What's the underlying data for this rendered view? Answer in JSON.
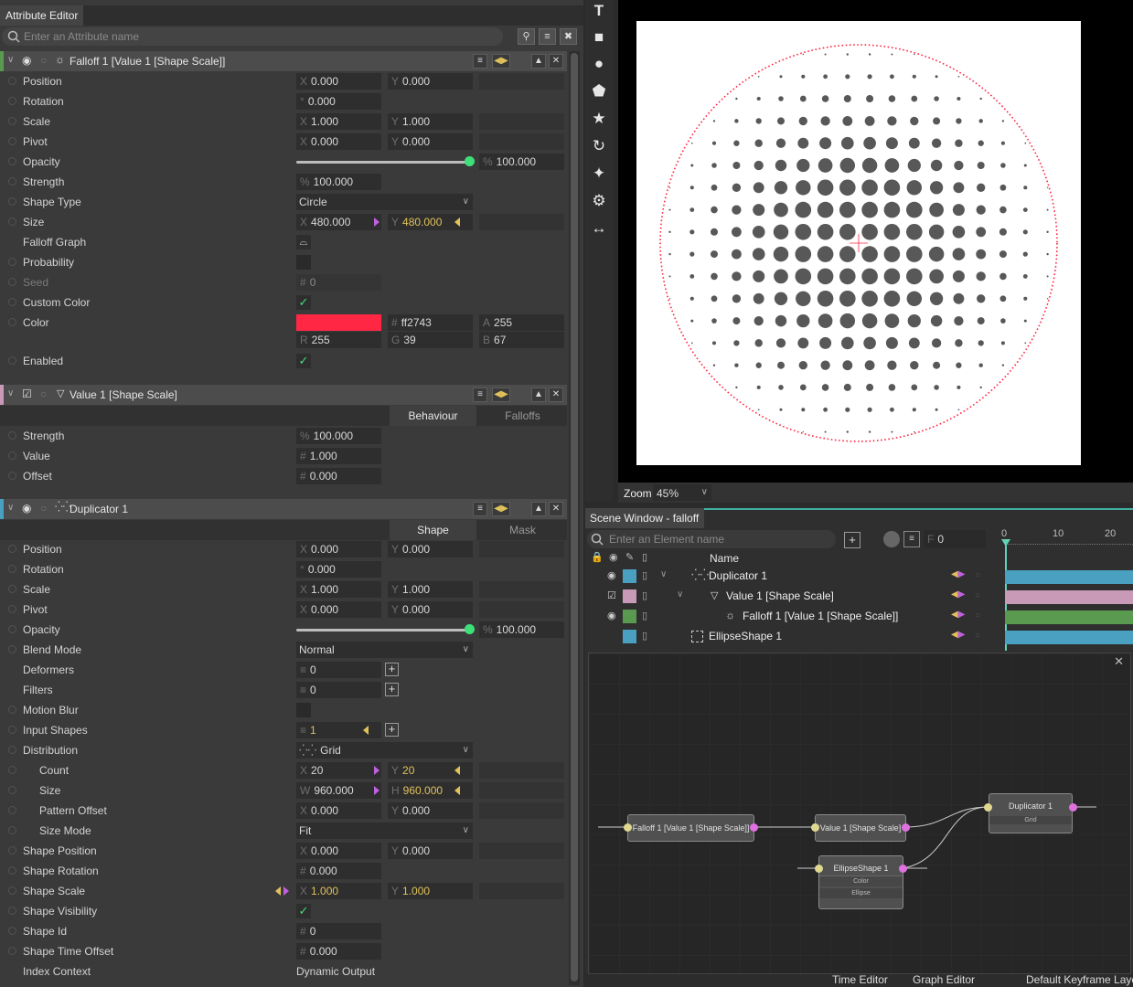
{
  "attribute_editor": {
    "title": "Attribute Editor",
    "search_placeholder": "Enter an Attribute name",
    "falloff": {
      "title": "Falloff 1 [Value 1 [Shape Scale]]",
      "position": {
        "label": "Position",
        "x": "0.000",
        "y": "0.000"
      },
      "rotation": {
        "label": "Rotation",
        "value": "0.000"
      },
      "scale": {
        "label": "Scale",
        "x": "1.000",
        "y": "1.000"
      },
      "pivot": {
        "label": "Pivot",
        "x": "0.000",
        "y": "0.000"
      },
      "opacity": {
        "label": "Opacity",
        "value": "100.000",
        "level": 1.0
      },
      "strength": {
        "label": "Strength",
        "value": "100.000"
      },
      "shape_type": {
        "label": "Shape Type",
        "value": "Circle"
      },
      "size": {
        "label": "Size",
        "x": "480.000",
        "y": "480.000"
      },
      "falloff_graph": {
        "label": "Falloff Graph"
      },
      "probability": {
        "label": "Probability"
      },
      "seed": {
        "label": "Seed",
        "value": "0"
      },
      "custom_color": {
        "label": "Custom Color"
      },
      "color": {
        "label": "Color",
        "swatch": "#ff2743",
        "hex": "ff2743",
        "a": "255",
        "r": "255",
        "g": "39",
        "b": "67"
      },
      "enabled": {
        "label": "Enabled"
      }
    },
    "value": {
      "title": "Value 1 [Shape Scale]",
      "tabs": [
        "Behaviour",
        "Falloffs"
      ],
      "strength": {
        "label": "Strength",
        "value": "100.000"
      },
      "value": {
        "label": "Value",
        "value": "1.000"
      },
      "offset": {
        "label": "Offset",
        "value": "0.000"
      }
    },
    "duplicator": {
      "title": "Duplicator 1",
      "tabs": [
        "Shape",
        "Mask"
      ],
      "position": {
        "label": "Position",
        "x": "0.000",
        "y": "0.000"
      },
      "rotation": {
        "label": "Rotation",
        "value": "0.000"
      },
      "scale": {
        "label": "Scale",
        "x": "1.000",
        "y": "1.000"
      },
      "pivot": {
        "label": "Pivot",
        "x": "0.000",
        "y": "0.000"
      },
      "opacity": {
        "label": "Opacity",
        "value": "100.000",
        "level": 1.0
      },
      "blend_mode": {
        "label": "Blend Mode",
        "value": "Normal"
      },
      "deformers": {
        "label": "Deformers",
        "value": "0"
      },
      "filters": {
        "label": "Filters",
        "value": "0"
      },
      "motion_blur": {
        "label": "Motion Blur"
      },
      "input_shapes": {
        "label": "Input Shapes",
        "value": "1"
      },
      "distribution": {
        "label": "Distribution",
        "value": "Grid"
      },
      "count": {
        "label": "Count",
        "x": "20",
        "y": "20"
      },
      "size": {
        "label": "Size",
        "w": "960.000",
        "h": "960.000"
      },
      "pattern_offset": {
        "label": "Pattern Offset",
        "x": "0.000",
        "y": "0.000"
      },
      "size_mode": {
        "label": "Size Mode",
        "value": "Fit"
      },
      "shape_position": {
        "label": "Shape Position",
        "x": "0.000",
        "y": "0.000"
      },
      "shape_rotation": {
        "label": "Shape Rotation",
        "value": "0.000"
      },
      "shape_scale": {
        "label": "Shape Scale",
        "x": "1.000",
        "y": "1.000"
      },
      "shape_visibility": {
        "label": "Shape Visibility"
      },
      "shape_id": {
        "label": "Shape Id",
        "value": "0"
      },
      "shape_time_offset": {
        "label": "Shape Time Offset",
        "value": "0.000"
      },
      "index_context": {
        "label": "Index Context",
        "value": "Dynamic Output"
      }
    }
  },
  "toolbar": {
    "icons": [
      "text-tool-icon",
      "rectangle-tool-icon",
      "ellipse-tool-icon",
      "polygon-tool-icon",
      "star-tool-icon",
      "arc-tool-icon",
      "spark-tool-icon",
      "gear-tool-icon",
      "arrows-tool-icon"
    ]
  },
  "viewport": {
    "zoom_label": "Zoom",
    "zoom_value": "45%",
    "falloff_color": "#ff2743"
  },
  "scene_window": {
    "title": "Scene Window - falloff",
    "search_placeholder": "Enter an Element name",
    "frame_label": "F",
    "frame_value": "0",
    "name_header": "Name",
    "timeline_ticks": [
      "0",
      "10",
      "20"
    ],
    "elements": [
      {
        "name": "Duplicator 1",
        "color": "#4aa0c0"
      },
      {
        "name": "Value 1 [Shape Scale]",
        "color": "#c89ab8"
      },
      {
        "name": "Falloff 1 [Value 1 [Shape Scale]]",
        "color": "#5a9a50"
      },
      {
        "name": "EllipseShape 1",
        "color": "#4aa0c0"
      }
    ],
    "bottom_tabs": [
      "Time Editor",
      "Graph Editor",
      "Default Keyframe Layer"
    ]
  },
  "node_graph": {
    "nodes": [
      {
        "title": "Falloff 1 [Value 1 [Shape Scale]]",
        "ports": []
      },
      {
        "title": "Value 1 [Shape Scale]",
        "ports": []
      },
      {
        "title": "Duplicator 1",
        "ports": [
          "Grid"
        ]
      },
      {
        "title": "EllipseShape 1",
        "ports": [
          "Color",
          "Ellipse"
        ]
      }
    ]
  }
}
